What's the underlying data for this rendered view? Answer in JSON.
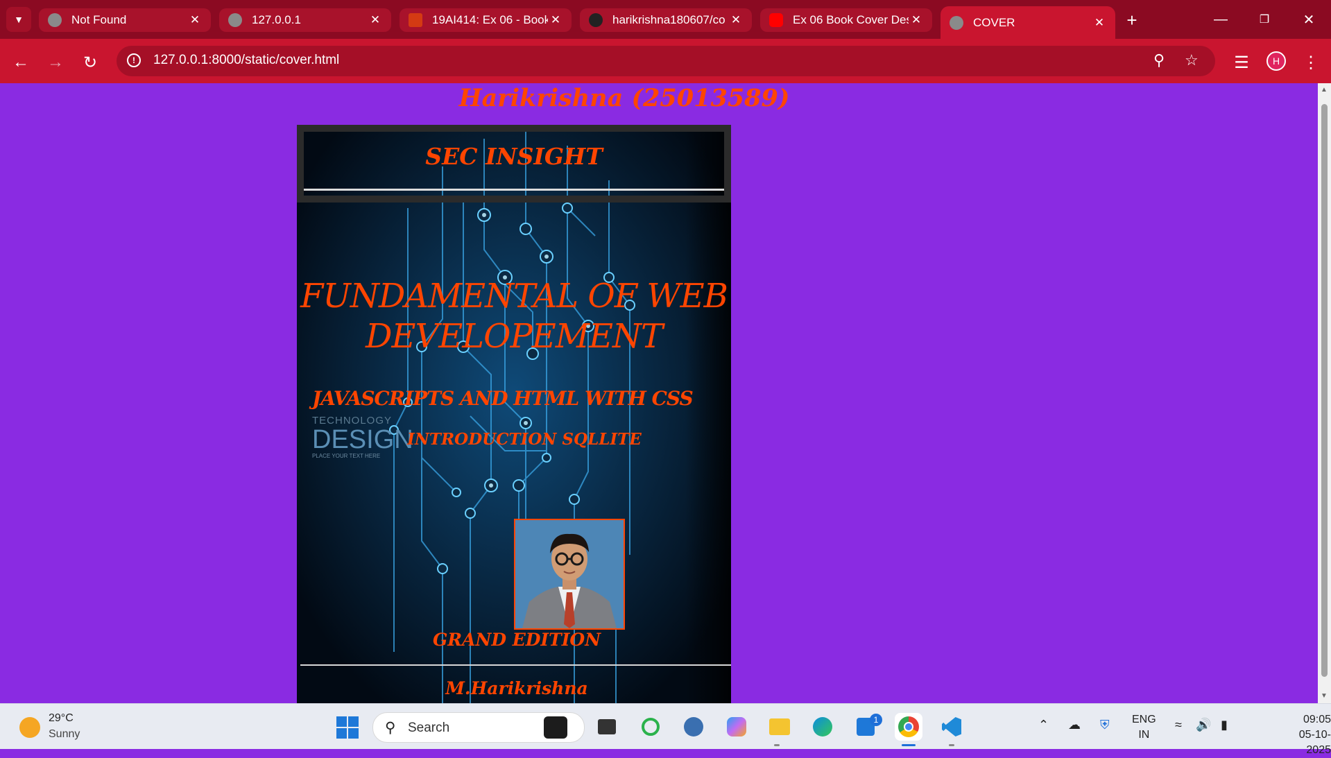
{
  "browser": {
    "tabs": [
      {
        "title": "Not Found",
        "favicon": "globe-icon"
      },
      {
        "title": "127.0.0.1",
        "favicon": "globe-icon"
      },
      {
        "title": "19AI414: Ex 06 - Book",
        "favicon": "moodle-icon"
      },
      {
        "title": "harikrishna180607/co",
        "favicon": "github-icon"
      },
      {
        "title": "Ex 06 Book Cover Des",
        "favicon": "youtube-icon"
      },
      {
        "title": "COVER",
        "favicon": "globe-icon",
        "active": true
      }
    ],
    "url": "127.0.0.1:8000/static/cover.html",
    "profile_initial": "H",
    "theme_color": "#c9152f"
  },
  "page": {
    "heading": "Harikrishna (25013589)",
    "background_color": "#8a2be2",
    "cover": {
      "header_title": "SEC INSIGHT",
      "main_title_line1": "FUNDAMENTAL OF WEB",
      "main_title_line2": "DEVELOPEMENT",
      "subtitle1": "JAVASCRIPTS AND HTML WITH CSS",
      "subtitle2": "INTRODUCTION SQLLITE",
      "watermark_tech": "TECHNOLOGY",
      "watermark_design": "DESIGN",
      "watermark_small": "PLACE YOUR TEXT HERE",
      "edition": "GRAND EDITION",
      "author": "M.Harikrishna",
      "text_color": "#ff4500"
    }
  },
  "taskbar": {
    "weather": {
      "temp": "29°C",
      "desc": "Sunny"
    },
    "search_placeholder": "Search",
    "store_badge": "1",
    "language_line1": "ENG",
    "language_line2": "IN",
    "time": "09:05",
    "date": "05-10-2025"
  }
}
